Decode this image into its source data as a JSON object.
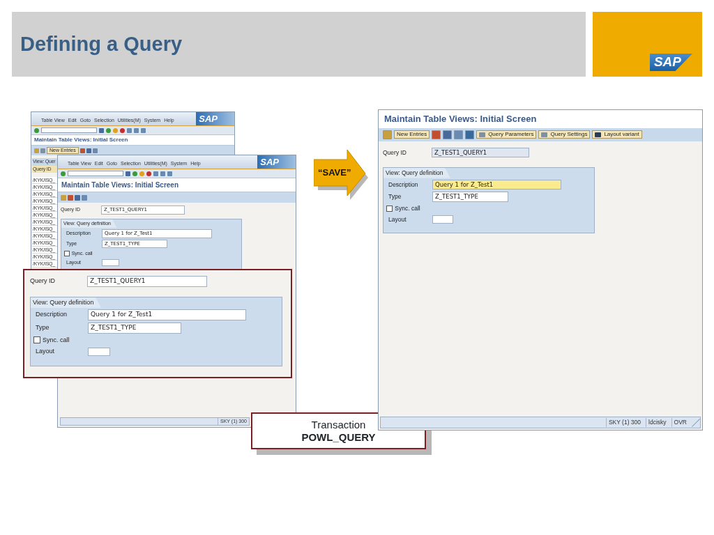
{
  "slide": {
    "title": "Defining a Query",
    "logo": "SAP"
  },
  "back_window": {
    "menu": [
      "Table View",
      "Edit",
      "Goto",
      "Selection",
      "Utilities(M)",
      "System",
      "Help"
    ],
    "logo": "SAP",
    "title": "Maintain Table Views: Initial Screen",
    "toolbar_button": "New Entries",
    "table": {
      "header": "View: Quer",
      "column": "Query ID",
      "rows": [
        "/KYK/ISQ_",
        "/KYK/ISQ_",
        "/KYK/ISQ_",
        "/KYK/ISQ_",
        "/KYK/ISQ_",
        "/KYK/ISQ_",
        "/KYK/ISQ_",
        "/KYK/ISQ_",
        "/KYK/ISQ_",
        "/KYK/ISQ_",
        "/KYK/ISQ_",
        "/KYK/ISQ_",
        "/KYK/ISQ_"
      ]
    }
  },
  "front_window": {
    "menu": [
      "Table View",
      "Edit",
      "Goto",
      "Selection",
      "Utilities(M)",
      "System",
      "Help"
    ],
    "logo": "SAP",
    "title": "Maintain Table Views: Initial Screen",
    "form": {
      "query_id": {
        "label": "Query ID",
        "value": "Z_TEST1_QUERY1",
        "readonly": false
      },
      "group": {
        "title": "View: Query definition",
        "fields": [
          {
            "kind": "text",
            "label": "Description",
            "value": "Query 1 for Z_Test1",
            "highlighted": false
          },
          {
            "kind": "text",
            "label": "Type",
            "value": "Z_TEST1_TYPE",
            "highlighted": false
          },
          {
            "kind": "checkbox",
            "label": "Sync. call",
            "checked": false
          },
          {
            "kind": "text",
            "label": "Layout",
            "highlighted": false
          }
        ]
      }
    },
    "status": [
      "SKY (1) 300"
    ]
  },
  "zoom_callout": {
    "form": {
      "query_id": {
        "label": "Query ID",
        "value": "Z_TEST1_QUERY1",
        "readonly": false
      },
      "group": {
        "title": "View: Query definition",
        "fields": [
          {
            "kind": "text",
            "label": "Description",
            "value": "Query 1 for Z_Test1",
            "highlighted": false
          },
          {
            "kind": "text",
            "label": "Type",
            "value": "Z_TEST1_TYPE",
            "highlighted": false
          },
          {
            "kind": "checkbox",
            "label": "Sync. call",
            "checked": false
          },
          {
            "kind": "text",
            "label": "Layout",
            "highlighted": false
          }
        ]
      }
    }
  },
  "save_arrow": {
    "label": "“SAVE”"
  },
  "transaction_box": {
    "label": "Transaction",
    "code": "POWL_QUERY"
  },
  "right_window": {
    "title": "Maintain Table Views: Initial Screen",
    "toolbar": [
      {
        "kind": "icon"
      },
      {
        "kind": "button",
        "label": "New Entries"
      },
      {
        "kind": "icon"
      },
      {
        "kind": "icon"
      },
      {
        "kind": "icon"
      },
      {
        "kind": "icon"
      },
      {
        "kind": "button",
        "label": "Query Parameters"
      },
      {
        "kind": "button",
        "label": "Query Settings"
      },
      {
        "kind": "button",
        "label": "Layout variant"
      }
    ],
    "form": {
      "query_id": {
        "label": "Query ID",
        "value": "Z_TEST1_QUERY1",
        "readonly": true
      },
      "group": {
        "title": "View: Query definition",
        "fields": [
          {
            "kind": "text",
            "label": "Description",
            "value": "Query 1 for Z_Test1",
            "highlighted": true
          },
          {
            "kind": "text",
            "label": "Type",
            "value": "Z_TEST1_TYPE",
            "highlighted": false
          },
          {
            "kind": "checkbox",
            "label": "Sync. call",
            "checked": false
          },
          {
            "kind": "text",
            "label": "Layout",
            "highlighted": false
          }
        ]
      }
    },
    "status": [
      "SKY (1) 300",
      "ldcisky",
      "OVR"
    ]
  }
}
